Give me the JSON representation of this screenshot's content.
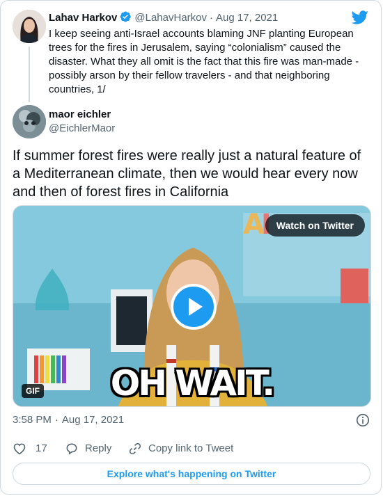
{
  "colors": {
    "accent": "#1d9bf0",
    "text": "#0f1419",
    "muted": "#536471",
    "border": "#cfd9de"
  },
  "parent_tweet": {
    "name": "Lahav Harkov",
    "handle": "@LahavHarkov",
    "separator": "·",
    "date": "Aug 17, 2021",
    "text": "I keep seeing anti-Israel accounts blaming JNF planting European trees for the fires in Jerusalem, saying “colonialism” caused the disaster. What they all omit is the fact that this fire was man-made - possibly arson by their fellow travelers - and that neighboring countries, 1/"
  },
  "tweet": {
    "name": "maor eichler",
    "handle": "@EichlerMaor",
    "text": "If summer forest fires were really just a natural feature of a Mediterranean climate, then we would hear every now and then of forest fires in California",
    "media": {
      "watch_label": "Watch on Twitter",
      "gif_badge": "GIF",
      "caption": "OH WAIT."
    },
    "time": "3:58 PM",
    "separator": "·",
    "date": "Aug 17, 2021",
    "likes": "17",
    "reply_label": "Reply",
    "copy_label": "Copy link to Tweet"
  },
  "footer": {
    "explore_label": "Explore what's happening on Twitter"
  },
  "icons": [
    "twitter-bird-icon",
    "verified-badge-icon",
    "play-icon",
    "info-icon",
    "heart-icon",
    "reply-icon",
    "link-icon"
  ]
}
